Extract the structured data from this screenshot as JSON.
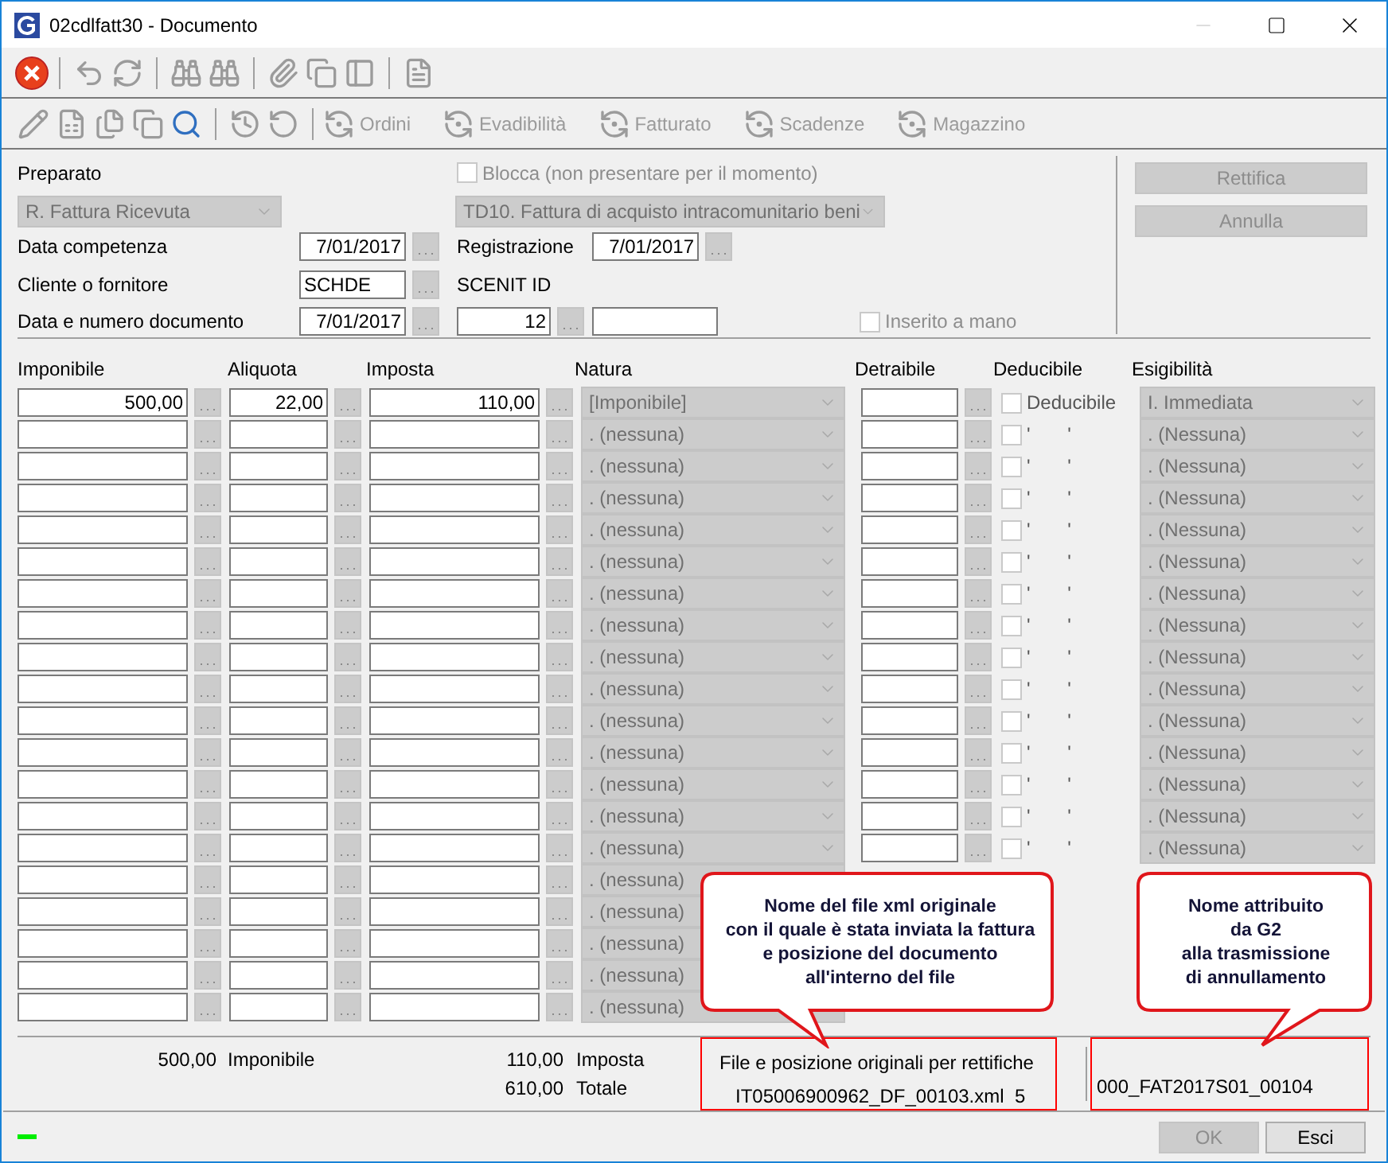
{
  "window": {
    "title": "02cdlfatt30 - Documento"
  },
  "toolbar_secondary": [
    {
      "label": "Ordini",
      "disabled": true
    },
    {
      "label": "Evadibilità",
      "disabled": true
    },
    {
      "label": "Fatturato",
      "disabled": true
    },
    {
      "label": "Scadenze",
      "disabled": true
    },
    {
      "label": "Magazzino",
      "disabled": true
    }
  ],
  "header": {
    "preparato": {
      "label": "Preparato",
      "value": "R. Fattura Ricevuta"
    },
    "blocca": {
      "label": "Blocca (non presentare per il momento)",
      "checked": false
    },
    "document_type": {
      "value": "TD10. Fattura di acquisto intracomunitario beni"
    },
    "data_competenza": {
      "label": "Data competenza",
      "value": "7/01/2017"
    },
    "registrazione": {
      "label": "Registrazione",
      "value": "7/01/2017"
    },
    "cliente": {
      "label": "Cliente o fornitore",
      "value": "SCHDE"
    },
    "scenit": {
      "label": "SCENIT ID"
    },
    "data_numero": {
      "label": "Data e numero documento",
      "date": "7/01/2017",
      "number": "12"
    },
    "inserito": {
      "label": "Inserito a mano",
      "checked": false
    },
    "buttons": [
      {
        "label": "Rettifica",
        "disabled": true
      },
      {
        "label": "Annulla",
        "disabled": true
      }
    ]
  },
  "columns": [
    "Imponibile",
    "Aliquota",
    "Imposta",
    "Natura",
    "Detraibile",
    "Deducibile",
    "Esigibilità"
  ],
  "rows": [
    {
      "kind": "full",
      "imponibile": "500,00",
      "aliquota": "22,00",
      "imposta": "110,00",
      "natura": "[Imponibile]",
      "deducibile": {
        "label": "Deducibile",
        "checked": false
      },
      "esigibilita": "I. Immediata"
    },
    {
      "kind": "full",
      "natura": ". (nessuna)",
      "deducibile": {
        "label": "'       '",
        "checked": false
      },
      "esigibilita": ". (Nessuna)"
    },
    {
      "kind": "full",
      "natura": ". (nessuna)",
      "deducibile": {
        "label": "'       '",
        "checked": false
      },
      "esigibilita": ". (Nessuna)"
    },
    {
      "kind": "full",
      "natura": ". (nessuna)",
      "deducibile": {
        "label": "'       '",
        "checked": false
      },
      "esigibilita": ". (Nessuna)"
    },
    {
      "kind": "full",
      "natura": ". (nessuna)",
      "deducibile": {
        "label": "'       '",
        "checked": false
      },
      "esigibilita": ". (Nessuna)"
    },
    {
      "kind": "full",
      "natura": ". (nessuna)",
      "deducibile": {
        "label": "'       '",
        "checked": false
      },
      "esigibilita": ". (Nessuna)"
    },
    {
      "kind": "full",
      "natura": ". (nessuna)",
      "deducibile": {
        "label": "'       '",
        "checked": false
      },
      "esigibilita": ". (Nessuna)"
    },
    {
      "kind": "full",
      "natura": ". (nessuna)",
      "deducibile": {
        "label": "'       '",
        "checked": false
      },
      "esigibilita": ". (Nessuna)"
    },
    {
      "kind": "full",
      "natura": ". (nessuna)",
      "deducibile": {
        "label": "'       '",
        "checked": false
      },
      "esigibilita": ". (Nessuna)"
    },
    {
      "kind": "full",
      "natura": ". (nessuna)",
      "deducibile": {
        "label": "'       '",
        "checked": false
      },
      "esigibilita": ". (Nessuna)"
    },
    {
      "kind": "full",
      "natura": ". (nessuna)",
      "deducibile": {
        "label": "'       '",
        "checked": false
      },
      "esigibilita": ". (Nessuna)"
    },
    {
      "kind": "full",
      "natura": ". (nessuna)",
      "deducibile": {
        "label": "'       '",
        "checked": false
      },
      "esigibilita": ". (Nessuna)"
    },
    {
      "kind": "full",
      "natura": ". (nessuna)",
      "deducibile": {
        "label": "'       '",
        "checked": false
      },
      "esigibilita": ". (Nessuna)"
    },
    {
      "kind": "full",
      "natura": ". (nessuna)",
      "deducibile": {
        "label": "'       '",
        "checked": false
      },
      "esigibilita": ". (Nessuna)"
    },
    {
      "kind": "full",
      "natura": ". (nessuna)",
      "deducibile": {
        "label": "'       '",
        "checked": false
      },
      "esigibilita": ". (Nessuna)"
    },
    {
      "kind": "covered",
      "natura": ". (nessuna)"
    },
    {
      "kind": "covered",
      "natura": ". (nessuna)"
    },
    {
      "kind": "covered",
      "natura": ". (nessuna)"
    },
    {
      "kind": "covered",
      "natura": ". (nessuna)"
    },
    {
      "kind": "covered",
      "natura": ". (nessuna)"
    }
  ],
  "totals": {
    "imponibile": {
      "value": "500,00",
      "label": "Imponibile"
    },
    "imposta": {
      "value": "110,00",
      "label": "Imposta"
    },
    "totale": {
      "value": "610,00",
      "label": "Totale"
    }
  },
  "original_file": {
    "label": "File e posizione originali per rettifiche",
    "value": "IT05006900962_DF_00103.xml  5"
  },
  "annulment_name": "000_FAT2017S01_00104",
  "callouts": [
    {
      "text": "Nome del file xml originale\ncon il quale è stata inviata la fattura\ne posizione del documento\nall'interno del file"
    },
    {
      "text": "Nome attribuito\nda G2\nalla trasmissione\ndi annullamento"
    }
  ],
  "footer_buttons": [
    {
      "label": "OK",
      "disabled": true
    },
    {
      "label": "Esci",
      "disabled": false
    }
  ]
}
